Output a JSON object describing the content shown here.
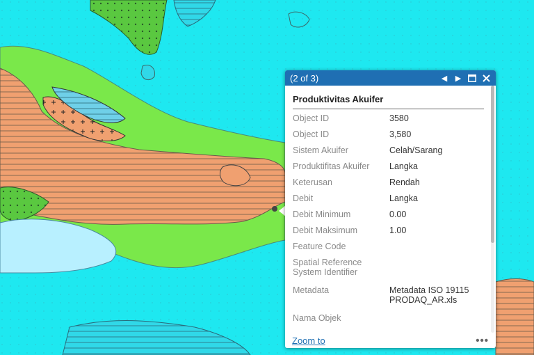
{
  "colors": {
    "water": "#1ee8f0",
    "shallow": "#b8f0ff",
    "lowland": "#7ae84a",
    "aquifer_orange": "#f0a070",
    "header": "#1f6fb3"
  },
  "popup": {
    "count": "(2 of 3)",
    "title": "Produktivitas Akuifer",
    "fields": [
      {
        "key": "Object ID",
        "value": "3580"
      },
      {
        "key": "Object ID",
        "value": "3,580"
      },
      {
        "key": "Sistem Akuifer",
        "value": "Celah/Sarang"
      },
      {
        "key": "Produktifitas Akuifer",
        "value": "Langka"
      },
      {
        "key": "Keterusan",
        "value": "Rendah"
      },
      {
        "key": "Debit",
        "value": "Langka"
      },
      {
        "key": "Debit Minimum",
        "value": "0.00"
      },
      {
        "key": "Debit Maksimum",
        "value": "1.00"
      },
      {
        "key": "Feature Code",
        "value": ""
      },
      {
        "key": "Spatial Reference System Identifier",
        "value": ""
      },
      {
        "key": "Metadata",
        "value": "Metadata ISO 19115 PRODAQ_AR.xls"
      },
      {
        "key": "Nama Objek",
        "value": ""
      }
    ],
    "zoom_label": "Zoom to",
    "more_label": "•••"
  },
  "icons": {
    "prev": "prev-arrow-icon",
    "next": "next-arrow-icon",
    "maximize": "maximize-icon",
    "close": "close-icon"
  }
}
